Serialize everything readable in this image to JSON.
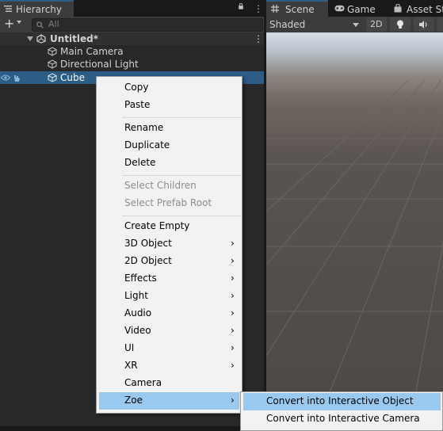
{
  "hierarchy": {
    "tab_label": "Hierarchy",
    "add_label": "+",
    "search_placeholder": "All",
    "scene_name": "Untitled*",
    "objects": [
      "Main Camera",
      "Directional Light",
      "Cube"
    ],
    "selected_object": "Cube",
    "menu_dots": "⋮"
  },
  "scene_panel": {
    "tabs": [
      "Scene",
      "Game",
      "Asset St"
    ],
    "shading_mode": "Shaded",
    "mode_2d": "2D"
  },
  "context_menu": {
    "group1": [
      "Copy",
      "Paste"
    ],
    "group2": [
      "Rename",
      "Duplicate",
      "Delete"
    ],
    "group3_disabled": [
      "Select Children",
      "Select Prefab Root"
    ],
    "group4": [
      {
        "label": "Create Empty",
        "submenu": false
      },
      {
        "label": "3D Object",
        "submenu": true
      },
      {
        "label": "2D Object",
        "submenu": true
      },
      {
        "label": "Effects",
        "submenu": true
      },
      {
        "label": "Light",
        "submenu": true
      },
      {
        "label": "Audio",
        "submenu": true
      },
      {
        "label": "Video",
        "submenu": true
      },
      {
        "label": "UI",
        "submenu": true
      },
      {
        "label": "XR",
        "submenu": true
      },
      {
        "label": "Camera",
        "submenu": false
      },
      {
        "label": "Zoe",
        "submenu": true
      }
    ],
    "highlighted_item": "Zoe",
    "chevron": "›"
  },
  "submenu": {
    "items": [
      "Convert into Interactive Object",
      "Convert into Interactive Camera"
    ],
    "highlighted_item": "Convert into Interactive Object"
  },
  "colors": {
    "selection_blue": "#2c5d87",
    "menu_highlight": "#99c9ef",
    "menu_background": "#f2f2f2",
    "panel_background": "#282828"
  }
}
